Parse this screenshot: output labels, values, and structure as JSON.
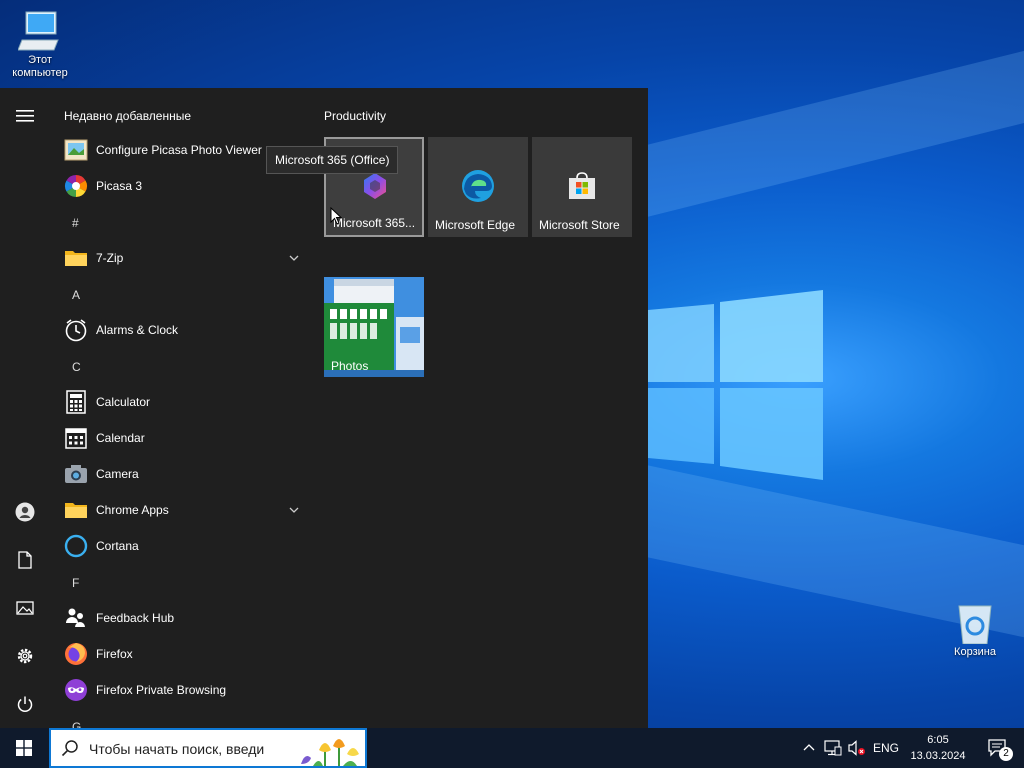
{
  "desktop": {
    "icons": [
      {
        "label": "Этот компьютер",
        "icon": "computer-icon"
      },
      {
        "label": "Корзина",
        "icon": "recycle-bin-icon"
      }
    ]
  },
  "start_menu": {
    "recent_title": "Недавно добавленные",
    "apps": [
      {
        "label": "Configure Picasa Photo Viewer",
        "icon": "picasa-viewer-icon"
      },
      {
        "label": "Picasa 3",
        "icon": "picasa-icon"
      },
      {
        "letter": "#"
      },
      {
        "label": "7-Zip",
        "icon": "folder-icon",
        "expandable": true
      },
      {
        "letter": "A"
      },
      {
        "label": "Alarms & Clock",
        "icon": "alarm-clock-icon"
      },
      {
        "letter": "C"
      },
      {
        "label": "Calculator",
        "icon": "calculator-icon"
      },
      {
        "label": "Calendar",
        "icon": "calendar-icon"
      },
      {
        "label": "Camera",
        "icon": "camera-icon"
      },
      {
        "label": "Chrome Apps",
        "icon": "folder-icon",
        "expandable": true
      },
      {
        "label": "Cortana",
        "icon": "cortana-icon"
      },
      {
        "letter": "F"
      },
      {
        "label": "Feedback Hub",
        "icon": "feedback-hub-icon"
      },
      {
        "label": "Firefox",
        "icon": "firefox-icon"
      },
      {
        "label": "Firefox Private Browsing",
        "icon": "firefox-private-icon"
      },
      {
        "letter": "G"
      }
    ],
    "rail_icons": [
      "hamburger-icon",
      "user-icon",
      "documents-icon",
      "pictures-icon",
      "settings-icon",
      "power-icon"
    ],
    "group_title": "Productivity",
    "tiles": [
      {
        "label": "Microsoft 365...",
        "icon": "microsoft-365-icon",
        "selected": true
      },
      {
        "label": "Microsoft Edge",
        "icon": "edge-icon"
      },
      {
        "label": "Microsoft Store",
        "icon": "store-icon"
      },
      {
        "label": "Photos",
        "icon": "photos-live-tile"
      }
    ],
    "tooltip": "Microsoft 365 (Office)"
  },
  "taskbar": {
    "search_placeholder": "Чтобы начать поиск, введи",
    "language": "ENG",
    "time": "6:05",
    "date": "13.03.2024",
    "notification_count": "2"
  },
  "colors": {
    "start_bg": "#1f1f1f",
    "tile_bg": "#3a3a3a",
    "accent": "#0e78d4",
    "taskbar_bg": "#0f1a2c"
  }
}
